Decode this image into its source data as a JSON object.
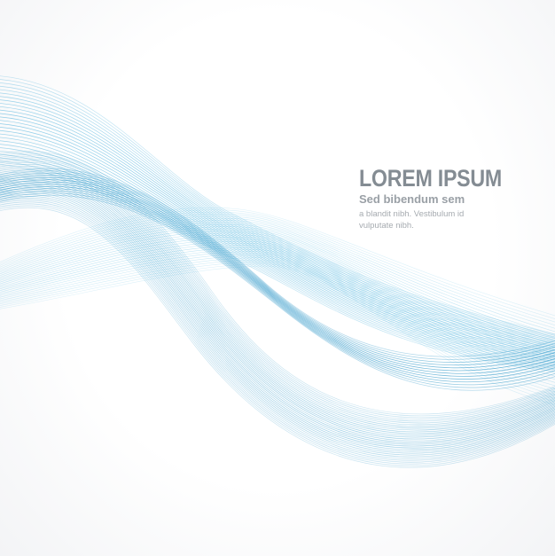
{
  "headline": "LOREM IPSUM",
  "subheadline": "Sed bibendum sem",
  "body_lines": [
    "a blandit nibh. Vestibulum id",
    "vulputate nibh."
  ],
  "colors": {
    "wave_dark": "#1f8fc4",
    "wave_mid": "#3aa9d8",
    "wave_light": "#7fcbe9",
    "background": "#ffffff",
    "headline": "#848c93",
    "body_text": "#a6abb0"
  }
}
